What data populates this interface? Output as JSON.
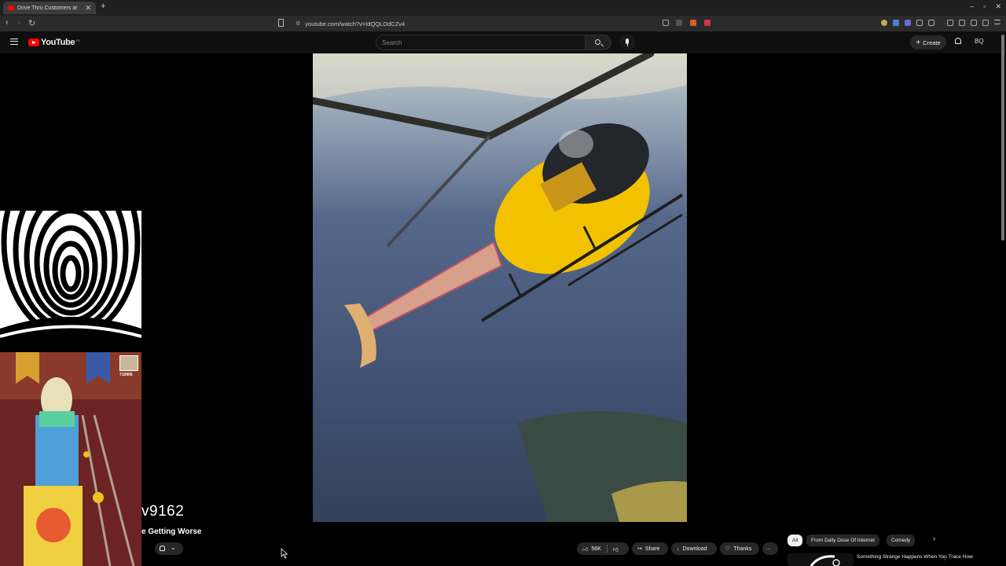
{
  "browser": {
    "tab_title": "Drive Thru Customers ar",
    "tab_close": "✕",
    "new_tab": "+",
    "url": "youtube.com/watch?v=IdQQLOdCZv4",
    "window_controls": [
      "–",
      "▫",
      "✕"
    ],
    "nav": {
      "back": "‹",
      "forward": "›",
      "reload": "↻"
    }
  },
  "header": {
    "logo_text": "YouTube",
    "logo_country": "PL",
    "search_placeholder": "Search",
    "create_label": "Create",
    "create_plus": "+",
    "avatar_text": "BQ"
  },
  "overlays": {
    "game_score": "719906",
    "username_text": "v9162"
  },
  "video": {
    "title_fragment": "e Getting Worse",
    "likes": "56K",
    "share_label": "Share",
    "download_label": "Download",
    "thanks_label": "Thanks",
    "more_label": "···"
  },
  "chips": [
    "All",
    "From Daily Dose Of Internet",
    "Comedy"
  ],
  "chips_next": "›",
  "recommendation": {
    "title": "Something Strange Happens When You Trace How",
    "more": "⋮"
  },
  "colors": {
    "brand": "#ff0000",
    "page_bg": "#0f0f0f",
    "chip_bg": "#272727",
    "helicopter": "#f2c200"
  }
}
